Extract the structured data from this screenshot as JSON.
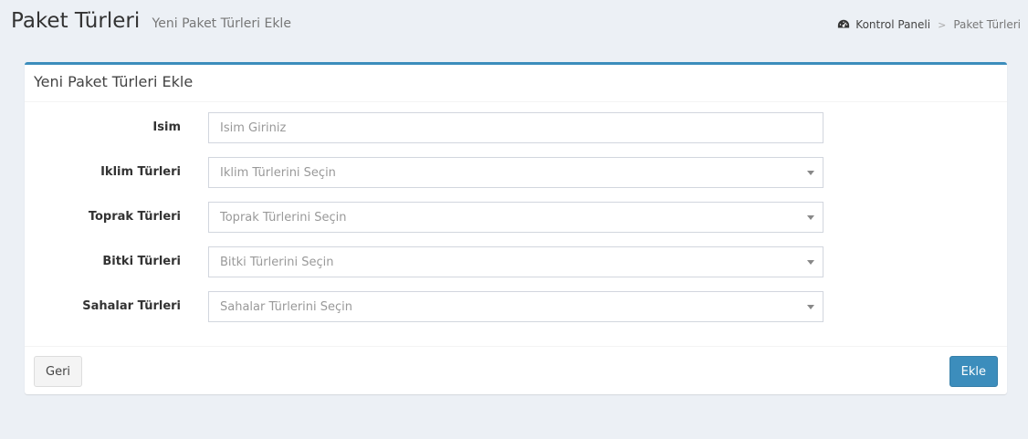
{
  "header": {
    "title": "Paket Türleri",
    "subtitle": "Yeni Paket Türleri Ekle"
  },
  "breadcrumb": {
    "icon": "dashboard-icon",
    "home": "Kontrol Paneli",
    "current": "Paket Türleri"
  },
  "box": {
    "title": "Yeni Paket Türleri Ekle",
    "accent_color": "#3c8dbc"
  },
  "form": {
    "name": {
      "label": "Isim",
      "value": "",
      "placeholder": "Isim Giriniz"
    },
    "climate": {
      "label": "Iklim Türleri",
      "selected": "Iklim Türlerini Seçin"
    },
    "soil": {
      "label": "Toprak Türleri",
      "selected": "Toprak Türlerini Seçin"
    },
    "plant": {
      "label": "Bitki Türleri",
      "selected": "Bitki Türlerini Seçin"
    },
    "fields": {
      "label": "Sahalar Türleri",
      "selected": "Sahalar Türlerini Seçin"
    }
  },
  "footer": {
    "back_label": "Geri",
    "add_label": "Ekle"
  }
}
